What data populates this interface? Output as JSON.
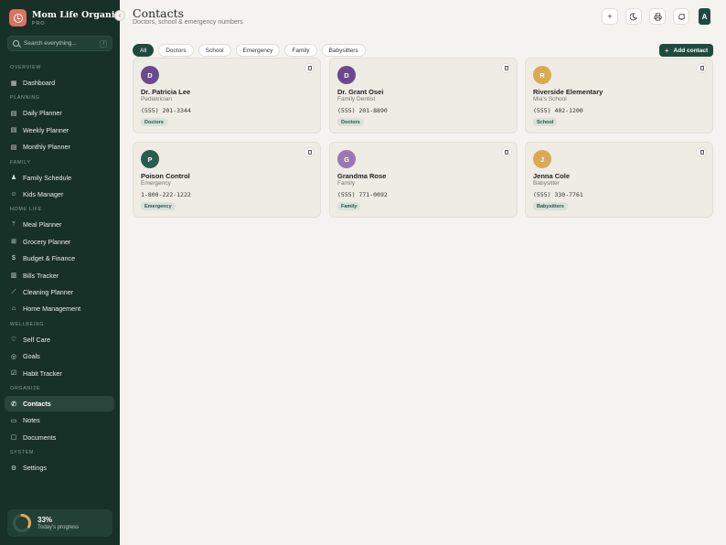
{
  "app": {
    "name": "Mom Life Organizer",
    "tier": "PRO"
  },
  "search": {
    "placeholder": "Search everything...",
    "shortcut": "/"
  },
  "sidebar": {
    "sections": [
      {
        "label": "OVERVIEW",
        "items": [
          {
            "label": "Dashboard",
            "icon": "grid-icon"
          }
        ]
      },
      {
        "label": "PLANNING",
        "items": [
          {
            "label": "Daily Planner",
            "icon": "calendar-icon"
          },
          {
            "label": "Weekly Planner",
            "icon": "calendar-icon"
          },
          {
            "label": "Monthly Planner",
            "icon": "calendar-icon"
          }
        ]
      },
      {
        "label": "FAMILY",
        "items": [
          {
            "label": "Family Schedule",
            "icon": "users-icon"
          },
          {
            "label": "Kids Manager",
            "icon": "smile-icon"
          }
        ]
      },
      {
        "label": "HOME LIFE",
        "items": [
          {
            "label": "Meal Planner",
            "icon": "utensils-icon"
          },
          {
            "label": "Grocery Planner",
            "icon": "cart-icon"
          },
          {
            "label": "Budget & Finance",
            "icon": "wallet-icon"
          },
          {
            "label": "Bills Tracker",
            "icon": "receipt-icon"
          },
          {
            "label": "Cleaning Planner",
            "icon": "broom-icon"
          },
          {
            "label": "Home Management",
            "icon": "home-icon"
          }
        ]
      },
      {
        "label": "WELLBEING",
        "items": [
          {
            "label": "Self Care",
            "icon": "heart-icon"
          },
          {
            "label": "Goals",
            "icon": "target-icon"
          },
          {
            "label": "Habit Tracker",
            "icon": "check-square-icon"
          }
        ]
      },
      {
        "label": "ORGANIZE",
        "items": [
          {
            "label": "Contacts",
            "icon": "phone-icon",
            "active": true
          },
          {
            "label": "Notes",
            "icon": "note-icon"
          },
          {
            "label": "Documents",
            "icon": "folder-icon"
          }
        ]
      },
      {
        "label": "SYSTEM",
        "items": [
          {
            "label": "Settings",
            "icon": "gear-icon"
          }
        ]
      }
    ]
  },
  "progress": {
    "percent_text": "33%",
    "value": 0.33,
    "label": "Today's progress",
    "color": "#e0a85a"
  },
  "header": {
    "title": "Contacts",
    "subtitle": "Doctors, school & emergency numbers",
    "avatar_initial": "A"
  },
  "filters": [
    {
      "label": "All",
      "active": true
    },
    {
      "label": "Doctors"
    },
    {
      "label": "School"
    },
    {
      "label": "Emergency"
    },
    {
      "label": "Family"
    },
    {
      "label": "Babysitters"
    }
  ],
  "add_contact_label": "Add contact",
  "contacts": [
    {
      "initial": "D",
      "name": "Dr. Patricia Lee",
      "role": "Pediatrician",
      "phone": "(555) 201-3344",
      "tag": "Doctors",
      "color": "#6a4a8c"
    },
    {
      "initial": "D",
      "name": "Dr. Grant Osei",
      "role": "Family Dentist",
      "phone": "(555) 201-8890",
      "tag": "Doctors",
      "color": "#6a4a8c"
    },
    {
      "initial": "R",
      "name": "Riverside Elementary",
      "role": "Mia's School",
      "phone": "(555) 402-1200",
      "tag": "School",
      "color": "#d9a954"
    },
    {
      "initial": "P",
      "name": "Poison Control",
      "role": "Emergency",
      "phone": "1-800-222-1222",
      "tag": "Emergency",
      "color": "#2a5c52"
    },
    {
      "initial": "G",
      "name": "Grandma Rose",
      "role": "Family",
      "phone": "(555) 771-0092",
      "tag": "Family",
      "color": "#9a78b4"
    },
    {
      "initial": "J",
      "name": "Jenna Cole",
      "role": "Babysitter",
      "phone": "(555) 330-7761",
      "tag": "Babysitters",
      "color": "#d9a954"
    }
  ]
}
